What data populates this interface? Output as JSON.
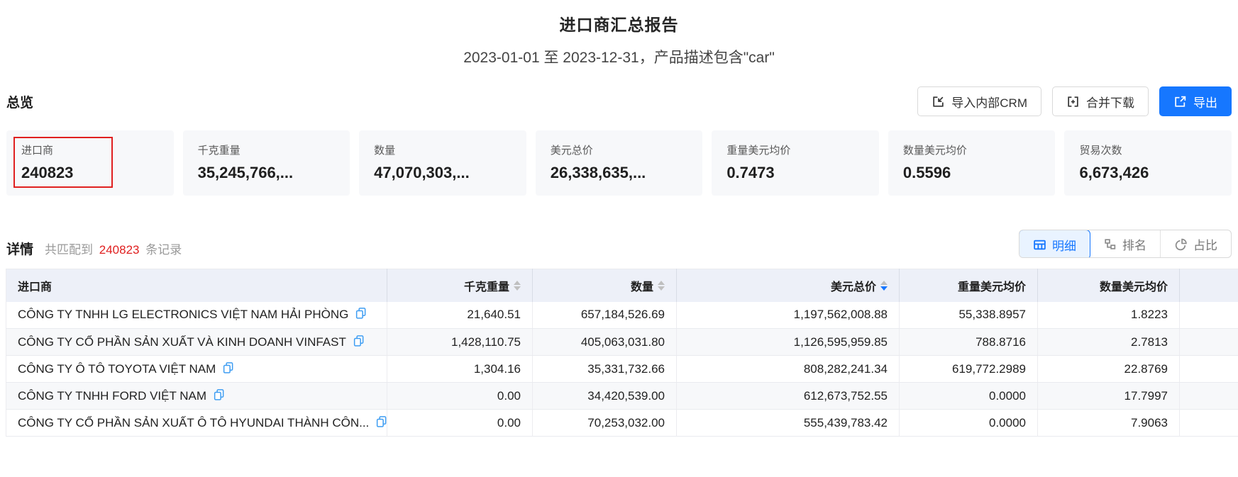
{
  "colors": {
    "accent_blue": "#1677ff",
    "highlight_red": "#e02020",
    "header_bg": "#edf0f8",
    "card_bg": "#f7f8fa"
  },
  "header": {
    "title": "进口商汇总报告",
    "subtitle": "2023-01-01 至 2023-12-31，产品描述包含\"car\""
  },
  "overview": {
    "section_title": "总览",
    "buttons": {
      "import_crm": {
        "label": "导入内部CRM",
        "icon": "import-icon"
      },
      "merge_download": {
        "label": "合并下载",
        "icon": "merge-icon"
      },
      "export": {
        "label": "导出",
        "icon": "export-icon"
      }
    },
    "cards": [
      {
        "label": "进口商",
        "value": "240823",
        "highlighted": true
      },
      {
        "label": "千克重量",
        "value": "35,245,766,..."
      },
      {
        "label": "数量",
        "value": "47,070,303,..."
      },
      {
        "label": "美元总价",
        "value": "26,338,635,..."
      },
      {
        "label": "重量美元均价",
        "value": "0.7473"
      },
      {
        "label": "数量美元均价",
        "value": "0.5596"
      },
      {
        "label": "贸易次数",
        "value": "6,673,426"
      }
    ]
  },
  "details": {
    "section_title": "详情",
    "match_prefix": "共匹配到",
    "match_count": "240823",
    "match_suffix": "条记录",
    "tabs": [
      {
        "label": "明细",
        "icon": "table-icon",
        "active": true
      },
      {
        "label": "排名",
        "icon": "ranking-icon",
        "active": false
      },
      {
        "label": "占比",
        "icon": "pie-icon",
        "active": false
      }
    ]
  },
  "table": {
    "columns": [
      {
        "label": "进口商",
        "sortable": false
      },
      {
        "label": "千克重量",
        "sortable": true,
        "sort": "none"
      },
      {
        "label": "数量",
        "sortable": true,
        "sort": "none"
      },
      {
        "label": "美元总价",
        "sortable": true,
        "sort": "desc"
      },
      {
        "label": "重量美元均价",
        "sortable": false
      },
      {
        "label": "数量美元均价",
        "sortable": false
      }
    ],
    "rows": [
      {
        "name": "CÔNG TY TNHH LG ELECTRONICS VIỆT NAM HẢI PHÒNG",
        "kg_weight": "21,640.51",
        "quantity": "657,184,526.69",
        "usd_total": "1,197,562,008.88",
        "usd_per_kg": "55,338.8957",
        "usd_per_qty": "1.8223"
      },
      {
        "name": "CÔNG TY CỔ PHẦN SẢN XUẤT VÀ KINH DOANH VINFAST",
        "kg_weight": "1,428,110.75",
        "quantity": "405,063,031.80",
        "usd_total": "1,126,595,959.85",
        "usd_per_kg": "788.8716",
        "usd_per_qty": "2.7813"
      },
      {
        "name": "CÔNG TY Ô TÔ TOYOTA VIỆT NAM",
        "kg_weight": "1,304.16",
        "quantity": "35,331,732.66",
        "usd_total": "808,282,241.34",
        "usd_per_kg": "619,772.2989",
        "usd_per_qty": "22.8769"
      },
      {
        "name": "CÔNG TY TNHH FORD VIỆT NAM",
        "kg_weight": "0.00",
        "quantity": "34,420,539.00",
        "usd_total": "612,673,752.55",
        "usd_per_kg": "0.0000",
        "usd_per_qty": "17.7997"
      },
      {
        "name": "CÔNG TY CỔ PHẦN SẢN XUẤT Ô TÔ HYUNDAI THÀNH CÔN...",
        "kg_weight": "0.00",
        "quantity": "70,253,032.00",
        "usd_total": "555,439,783.42",
        "usd_per_kg": "0.0000",
        "usd_per_qty": "7.9063"
      }
    ]
  }
}
